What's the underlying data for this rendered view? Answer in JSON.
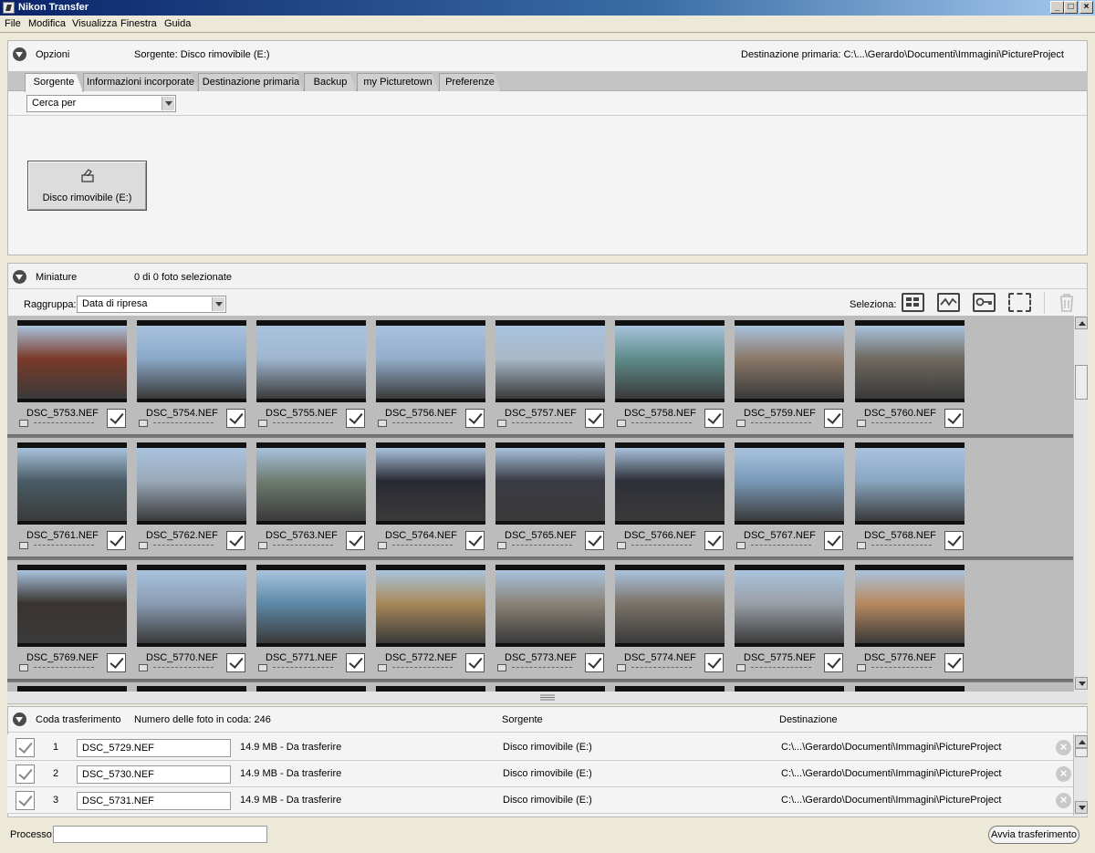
{
  "window": {
    "title": "Nikon Transfer",
    "buttons": {
      "minimize": "_",
      "maximize": "□",
      "close": "×"
    }
  },
  "menu": [
    "File",
    "Modifica",
    "Visualizza",
    "Finestra",
    "Guida"
  ],
  "options": {
    "label": "Opzioni",
    "source_info": "Sorgente: Disco rimovibile (E:)",
    "destination_info": "Destinazione primaria: C:\\...\\Gerardo\\Documenti\\Immagini\\PictureProject",
    "tabs": [
      "Sorgente",
      "Informazioni incorporate",
      "Destinazione primaria",
      "Backup",
      "my Picturetown",
      "Preferenze"
    ],
    "active_tab": "Sorgente",
    "search_by": "Cerca per",
    "source_device": "Disco rimovibile (E:)"
  },
  "thumbnails": {
    "label": "Miniature",
    "selection_count": "0 di 0 foto selezionate",
    "group_label": "Raggruppa:",
    "group_value": "Data di ripresa",
    "select_label": "Seleziona:",
    "select_icons": [
      "select-all-icon",
      "select-new-icon",
      "select-protected-icon",
      "select-none-icon",
      "trash-icon"
    ],
    "rows": [
      [
        "DSC_5753.NEF",
        "DSC_5754.NEF",
        "DSC_5755.NEF",
        "DSC_5756.NEF",
        "DSC_5757.NEF",
        "DSC_5758.NEF",
        "DSC_5759.NEF",
        "DSC_5760.NEF"
      ],
      [
        "DSC_5761.NEF",
        "DSC_5762.NEF",
        "DSC_5763.NEF",
        "DSC_5764.NEF",
        "DSC_5765.NEF",
        "DSC_5766.NEF",
        "DSC_5767.NEF",
        "DSC_5768.NEF"
      ],
      [
        "DSC_5769.NEF",
        "DSC_5770.NEF",
        "DSC_5771.NEF",
        "DSC_5772.NEF",
        "DSC_5773.NEF",
        "DSC_5774.NEF",
        "DSC_5775.NEF",
        "DSC_5776.NEF"
      ]
    ],
    "photo_colors": [
      [
        "#7b3a2a",
        "#8aa8c8",
        "#9fb6d0",
        "#94aecb",
        "#a8b8c8",
        "#5e8c8a",
        "#8b7868",
        "#6f6a60"
      ],
      [
        "#4a5c66",
        "#9aa8b8",
        "#6e7c70",
        "#2a2a34",
        "#3a3a44",
        "#2e3038",
        "#7a9ab8",
        "#8aa6c0"
      ],
      [
        "#3a3430",
        "#8a9cb4",
        "#5e8aa8",
        "#a88a5a",
        "#8a8478",
        "#7c746a",
        "#9aa0a8",
        "#b88a60"
      ]
    ]
  },
  "queue": {
    "label": "Coda trasferimento",
    "count": "Numero delle foto in coda: 246",
    "col_source": "Sorgente",
    "col_destination": "Destinazione",
    "items": [
      {
        "num": "1",
        "name": "DSC_5729.NEF",
        "info": "14.9 MB - Da trasferire",
        "source": "Disco rimovibile (E:)",
        "dest": "C:\\...\\Gerardo\\Documenti\\Immagini\\PictureProject"
      },
      {
        "num": "2",
        "name": "DSC_5730.NEF",
        "info": "14.9 MB - Da trasferire",
        "source": "Disco rimovibile (E:)",
        "dest": "C:\\...\\Gerardo\\Documenti\\Immagini\\PictureProject"
      },
      {
        "num": "3",
        "name": "DSC_5731.NEF",
        "info": "14.9 MB - Da trasferire",
        "source": "Disco rimovibile (E:)",
        "dest": "C:\\...\\Gerardo\\Documenti\\Immagini\\PictureProject"
      }
    ],
    "delete_glyph": "×"
  },
  "footer": {
    "process_label": "Processo:",
    "process_value": "",
    "start_button": "Avvia trasferimento"
  }
}
